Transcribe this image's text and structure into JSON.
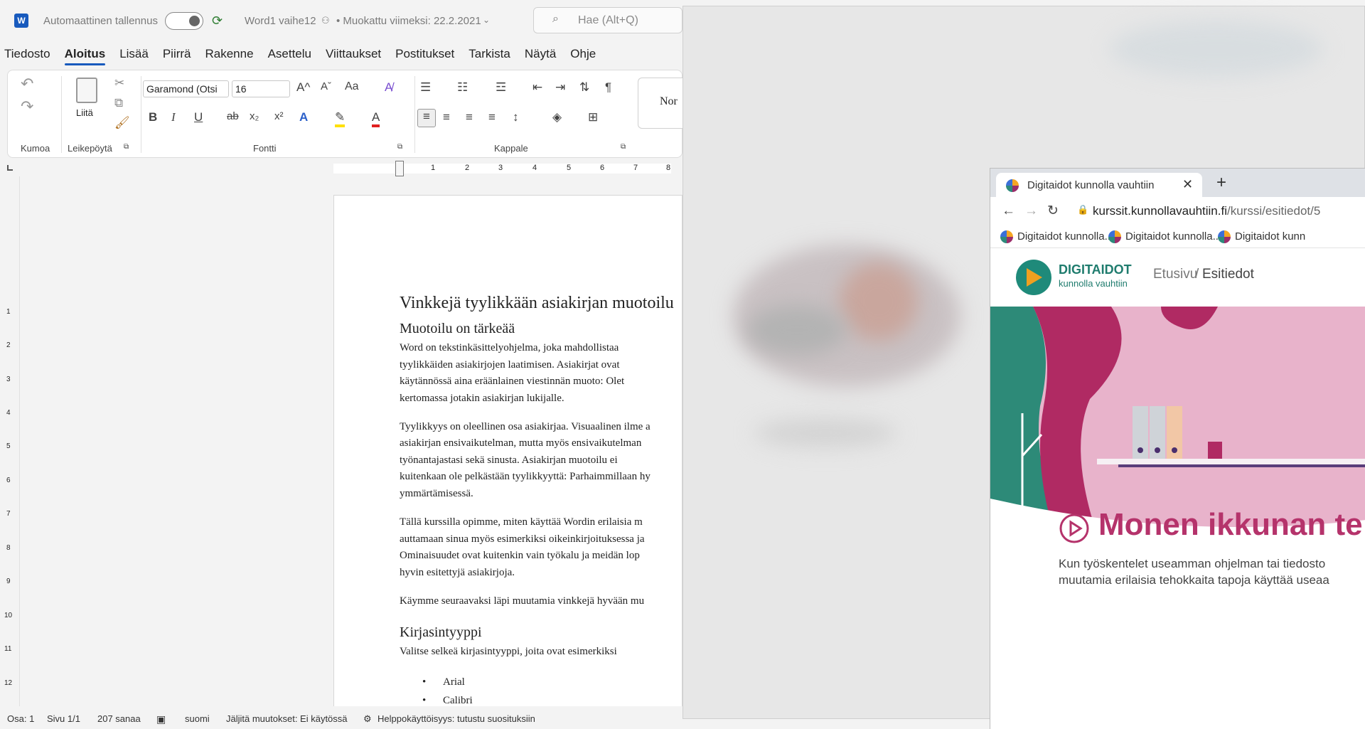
{
  "word": {
    "autosave_label": "Automaattinen tallennus",
    "doc_name": "Word1 vaihe12",
    "modified": "• Muokattu viimeksi: 22.2.2021",
    "search_placeholder": "Hae (Alt+Q)",
    "tabs": [
      "Tiedosto",
      "Aloitus",
      "Lisää",
      "Piirrä",
      "Rakenne",
      "Asettelu",
      "Viittaukset",
      "Postitukset",
      "Tarkista",
      "Näytä",
      "Ohje"
    ],
    "active_tab": "Aloitus",
    "ribbon": {
      "undo_group": "Kumoa",
      "paste_label": "Liitä",
      "clipboard_group": "Leikepöytä",
      "font_name": "Garamond (Otsi",
      "font_size": "16",
      "font_group": "Fontti",
      "paragraph_group": "Kappale",
      "style_preview": "Nor",
      "bold": "B",
      "italic": "I",
      "underline": "U",
      "strike": "ab",
      "subscript": "x₂",
      "superscript": "x²",
      "grow": "A^",
      "shrink": "Aˇ",
      "case": "Aa"
    },
    "ruler_ticks": [
      "1",
      "2",
      "3",
      "4",
      "5",
      "6",
      "7",
      "8"
    ],
    "vruler_ticks": [
      "1",
      "1",
      "2",
      "3",
      "4",
      "5",
      "6",
      "7",
      "8",
      "9",
      "10",
      "11",
      "12"
    ],
    "document": {
      "title": "Vinkkejä tyylikkään asiakirjan muotoilu",
      "subheading1": "Muotoilu on tärkeää",
      "para1": [
        "Word on tekstinkäsittelyohjelma, joka mahdollistaa",
        "tyylikkäiden asiakirjojen laatimisen. Asiakirjat ovat",
        "käytännössä aina eräänlainen viestinnän muoto: Olet",
        "kertomassa jotakin asiakirjan lukijalle."
      ],
      "para2": [
        "Tyylikkyys on oleellinen osa asiakirjaa. Visuaalinen ilme a",
        "asiakirjan ensivaikutelman, mutta myös ensivaikutelman",
        "työnantajastasi sekä sinusta. Asiakirjan muotoilu ei",
        "kuitenkaan ole pelkästään tyylikkyyttä: Parhaimmillaan hy",
        "ymmärtämisessä."
      ],
      "para3": [
        "Tällä kurssilla opimme, miten käyttää Wordin erilaisia m",
        "auttamaan sinua myös esimerkiksi oikeinkirjoituksessa ja",
        "Ominaisuudet ovat kuitenkin vain työkalu ja meidän lop",
        "hyvin esitettyjä asiakirjoja."
      ],
      "para4": "Käymme seuraavaksi läpi muutamia vinkkejä hyvään mu",
      "subheading2": "Kirjasintyyppi",
      "para5": "Valitse selkeä kirjasintyyppi, joita ovat esimerkiksi",
      "bullets": [
        "Arial",
        "Calibri"
      ]
    },
    "status": {
      "section": "Osa: 1",
      "page": "Sivu 1/1",
      "words": "207 sanaa",
      "language": "suomi",
      "track": "Jäljitä muutokset: Ei käytössä",
      "accessibility": "Helppokäyttöisyys: tutustu suosituksiin"
    }
  },
  "browser": {
    "tab_title": "Digitaidot kunnolla vauhtiin",
    "url_domain": "kurssit.kunnollavauhtiin.fi",
    "url_path": "/kurssi/esitiedot/5",
    "bookmarks": [
      "Digitaidot kunnolla...",
      "Digitaidot kunnolla...",
      "Digitaidot kunn"
    ],
    "site": {
      "logo_title": "DIGITAIDOT",
      "logo_subtitle": "kunnolla vauhtiin",
      "breadcrumb_home": "Etusivu",
      "breadcrumb_sep": "/",
      "breadcrumb_current": "Esitiedot",
      "heading": "Monen ikkunan te",
      "body_line1": "Kun työskentelet useamman ohjelman tai tiedosto",
      "body_line2": "muutamia erilaisia tehokkaita tapoja käyttää useaa"
    }
  },
  "colors": {
    "word_blue": "#185abd",
    "site_heading": "#b5336b",
    "hero_pink": "#e8b3cb"
  }
}
